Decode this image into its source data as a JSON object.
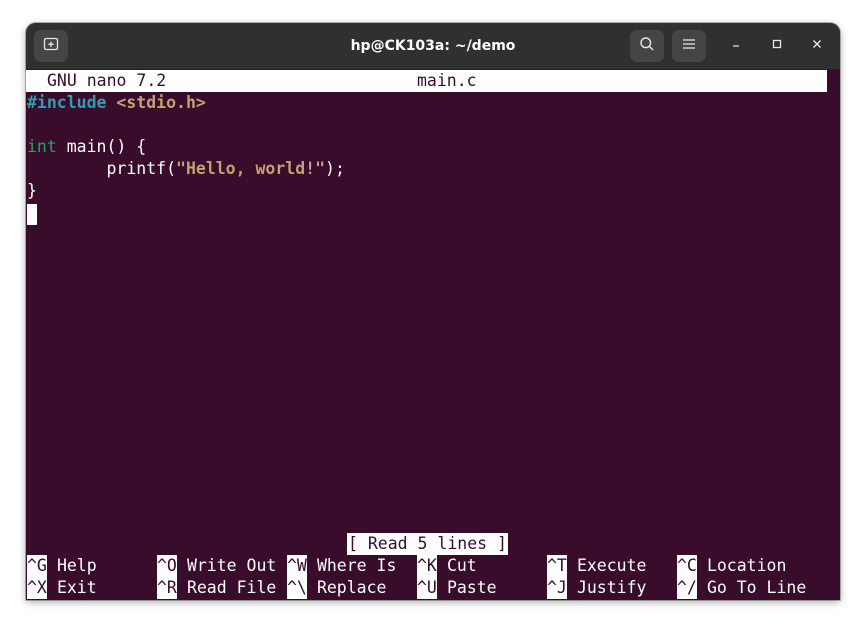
{
  "window": {
    "title": "hp@CK103a: ~/demo",
    "icons": {
      "new_tab": "new-tab-icon",
      "search": "search-icon",
      "menu": "hamburger-menu-icon",
      "minimize": "minimize-icon",
      "maximize": "maximize-icon",
      "close": "close-icon"
    }
  },
  "nano": {
    "version_label": "GNU nano 7.2",
    "filename": "main.c",
    "status_message": "[ Read 5 lines ]",
    "code": {
      "l1_directive": "#include",
      "l1_header": "<stdio.h>",
      "l3_type": "int",
      "l3_rest": " main() {",
      "l4_indent": "        printf(",
      "l4_string": "\"Hello, world!\"",
      "l4_end": ");",
      "l5": "}"
    },
    "shortcuts": [
      {
        "key": "^G",
        "label": "Help"
      },
      {
        "key": "^O",
        "label": "Write Out"
      },
      {
        "key": "^W",
        "label": "Where Is"
      },
      {
        "key": "^K",
        "label": "Cut"
      },
      {
        "key": "^T",
        "label": "Execute"
      },
      {
        "key": "^C",
        "label": "Location"
      },
      {
        "key": "^X",
        "label": "Exit"
      },
      {
        "key": "^R",
        "label": "Read File"
      },
      {
        "key": "^\\",
        "label": "Replace"
      },
      {
        "key": "^U",
        "label": "Paste"
      },
      {
        "key": "^J",
        "label": "Justify"
      },
      {
        "key": "^/",
        "label": "Go To Line"
      }
    ]
  },
  "colors": {
    "terminal_bg": "#380c2a",
    "titlebar_bg": "#303030",
    "preprocessor": "#2aa1b3",
    "type_keyword": "#26a269",
    "string": "#c79f72"
  }
}
